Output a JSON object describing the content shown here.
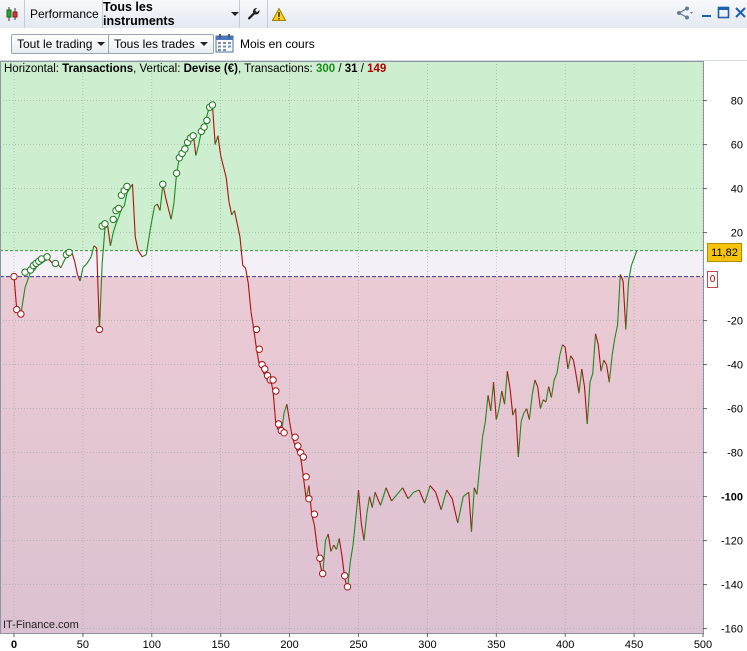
{
  "titlebar": {
    "tab_performance": "Performance",
    "tab_instruments": "Tous les instruments",
    "icon_app": "candlestick-icon",
    "icon_tools": "wrench-icon",
    "icon_warning": "warning-icon",
    "icon_share": "share-icon",
    "icon_minimize": "minimize-icon",
    "icon_maximize": "maximize-icon",
    "icon_close": "close-icon"
  },
  "toolbar": {
    "filter_trading": "Tout le trading",
    "filter_trades": "Tous les trades",
    "period_label": "Mois en cours",
    "icon_calendar": "calendar-icon"
  },
  "header": {
    "horizontal_label": "Horizontal: ",
    "horizontal_value": "Transactions",
    "vertical_label": ", Vertical: ",
    "vertical_value": "Devise (€)",
    "transactions_label": ", Transactions: ",
    "count_winning": "300",
    "separator1": " / ",
    "count_neutral": "31",
    "separator2": " / ",
    "count_losing": "149"
  },
  "footer": {
    "source": "IT-Finance.com"
  },
  "current_value_label": "11,82",
  "zero_marker_label": "0",
  "colors": {
    "positive_zone": "#cdeecf",
    "negative_zone": "#e6c8d3",
    "neutral_band": "#f4f0f8",
    "up_line": "#1e8a1e",
    "down_line": "#b01010",
    "win_count": "#1c8c1c",
    "loss_count": "#b00000",
    "current_badge": "#f6c40c"
  },
  "chart_data": {
    "type": "line",
    "xlim": [
      -10,
      500
    ],
    "ylim": [
      -162,
      98
    ],
    "x_ticks": [
      0,
      50,
      100,
      150,
      200,
      250,
      300,
      350,
      400,
      450,
      500
    ],
    "y_ticks": [
      80,
      60,
      40,
      20,
      -20,
      -40,
      -60,
      -80,
      -100,
      -120,
      -140,
      -160
    ],
    "grid": true,
    "current_value": 11.82,
    "neutral_band": [
      0,
      11.82
    ],
    "series": [
      {
        "points": [
          [
            0,
            0
          ],
          [
            2,
            -15
          ],
          [
            5,
            -17
          ],
          [
            8,
            -5
          ],
          [
            12,
            2
          ],
          [
            15,
            3
          ],
          [
            17,
            5
          ],
          [
            20,
            6
          ],
          [
            22,
            7
          ],
          [
            25,
            8
          ],
          [
            28,
            6
          ],
          [
            30,
            7
          ],
          [
            34,
            4
          ],
          [
            37,
            8
          ],
          [
            40,
            10
          ],
          [
            42,
            11
          ],
          [
            44,
            7
          ],
          [
            46,
            1
          ],
          [
            48,
            -2
          ],
          [
            50,
            4
          ],
          [
            53,
            6
          ],
          [
            56,
            9
          ],
          [
            58,
            14
          ],
          [
            60,
            13
          ],
          [
            62,
            -24
          ],
          [
            64,
            6
          ],
          [
            66,
            22
          ],
          [
            68,
            23
          ],
          [
            70,
            14
          ],
          [
            72,
            20
          ],
          [
            74,
            24
          ],
          [
            76,
            27
          ],
          [
            78,
            31
          ],
          [
            80,
            32
          ],
          [
            82,
            38
          ],
          [
            84,
            40
          ],
          [
            86,
            42
          ],
          [
            88,
            18
          ],
          [
            90,
            12
          ],
          [
            93,
            9
          ],
          [
            96,
            10
          ],
          [
            99,
            22
          ],
          [
            102,
            32
          ],
          [
            104,
            33
          ],
          [
            106,
            30
          ],
          [
            108,
            42
          ],
          [
            110,
            36
          ],
          [
            112,
            31
          ],
          [
            114,
            26
          ],
          [
            116,
            33
          ],
          [
            118,
            47
          ],
          [
            120,
            54
          ],
          [
            122,
            57
          ],
          [
            124,
            59
          ],
          [
            126,
            62
          ],
          [
            128,
            64
          ],
          [
            130,
            65
          ],
          [
            132,
            55
          ],
          [
            134,
            60
          ],
          [
            136,
            66
          ],
          [
            138,
            68
          ],
          [
            140,
            73
          ],
          [
            142,
            78
          ],
          [
            144,
            78
          ],
          [
            146,
            60
          ],
          [
            148,
            64
          ],
          [
            150,
            55
          ],
          [
            152,
            50
          ],
          [
            154,
            45
          ],
          [
            156,
            34
          ],
          [
            158,
            28
          ],
          [
            160,
            30
          ],
          [
            162,
            24
          ],
          [
            164,
            18
          ],
          [
            166,
            5
          ],
          [
            168,
            4
          ],
          [
            170,
            -3
          ],
          [
            172,
            -16
          ],
          [
            174,
            -24
          ],
          [
            176,
            -33
          ],
          [
            178,
            -40
          ],
          [
            180,
            -42
          ],
          [
            182,
            -45
          ],
          [
            184,
            -47
          ],
          [
            186,
            -46
          ],
          [
            188,
            -52
          ],
          [
            190,
            -67
          ],
          [
            192,
            -70
          ],
          [
            194,
            -71
          ],
          [
            196,
            -62
          ],
          [
            198,
            -58
          ],
          [
            200,
            -66
          ],
          [
            202,
            -73
          ],
          [
            204,
            -77
          ],
          [
            206,
            -80
          ],
          [
            208,
            -82
          ],
          [
            210,
            -91
          ],
          [
            212,
            -101
          ],
          [
            214,
            -95
          ],
          [
            216,
            -108
          ],
          [
            218,
            -113
          ],
          [
            220,
            -123
          ],
          [
            222,
            -130
          ],
          [
            224,
            -136
          ],
          [
            226,
            -120
          ],
          [
            228,
            -117
          ],
          [
            230,
            -125
          ],
          [
            232,
            -122
          ],
          [
            234,
            -124
          ],
          [
            236,
            -119
          ],
          [
            238,
            -127
          ],
          [
            240,
            -137
          ],
          [
            242,
            -142
          ],
          [
            244,
            -130
          ],
          [
            246,
            -122
          ],
          [
            248,
            -110
          ],
          [
            250,
            -97
          ],
          [
            252,
            -112
          ],
          [
            254,
            -120
          ],
          [
            256,
            -108
          ],
          [
            258,
            -100
          ],
          [
            260,
            -105
          ],
          [
            262,
            -98
          ],
          [
            266,
            -104
          ],
          [
            270,
            -96
          ],
          [
            274,
            -102
          ],
          [
            278,
            -99
          ],
          [
            282,
            -96
          ],
          [
            286,
            -101
          ],
          [
            290,
            -98
          ],
          [
            294,
            -97
          ],
          [
            298,
            -103
          ],
          [
            302,
            -95
          ],
          [
            306,
            -98
          ],
          [
            310,
            -106
          ],
          [
            314,
            -97
          ],
          [
            318,
            -101
          ],
          [
            322,
            -112
          ],
          [
            326,
            -100
          ],
          [
            330,
            -98
          ],
          [
            332,
            -116
          ],
          [
            334,
            -96
          ],
          [
            336,
            -99
          ],
          [
            338,
            -86
          ],
          [
            340,
            -73
          ],
          [
            342,
            -66
          ],
          [
            344,
            -54
          ],
          [
            346,
            -61
          ],
          [
            348,
            -48
          ],
          [
            350,
            -65
          ],
          [
            352,
            -60
          ],
          [
            354,
            -52
          ],
          [
            356,
            -58
          ],
          [
            358,
            -43
          ],
          [
            360,
            -51
          ],
          [
            362,
            -63
          ],
          [
            364,
            -60
          ],
          [
            366,
            -82
          ],
          [
            368,
            -66
          ],
          [
            370,
            -62
          ],
          [
            372,
            -60
          ],
          [
            374,
            -65
          ],
          [
            376,
            -54
          ],
          [
            378,
            -47
          ],
          [
            380,
            -50
          ],
          [
            382,
            -60
          ],
          [
            384,
            -56
          ],
          [
            386,
            -57
          ],
          [
            388,
            -50
          ],
          [
            390,
            -55
          ],
          [
            392,
            -47
          ],
          [
            394,
            -44
          ],
          [
            396,
            -36
          ],
          [
            398,
            -31
          ],
          [
            400,
            -32
          ],
          [
            402,
            -42
          ],
          [
            404,
            -36
          ],
          [
            406,
            -38
          ],
          [
            408,
            -45
          ],
          [
            410,
            -53
          ],
          [
            412,
            -42
          ],
          [
            414,
            -50
          ],
          [
            416,
            -67
          ],
          [
            418,
            -48
          ],
          [
            420,
            -44
          ],
          [
            422,
            -26
          ],
          [
            424,
            -31
          ],
          [
            426,
            -43
          ],
          [
            428,
            -38
          ],
          [
            430,
            -40
          ],
          [
            432,
            -48
          ],
          [
            434,
            -36
          ],
          [
            436,
            -28
          ],
          [
            438,
            -22
          ],
          [
            440,
            1
          ],
          [
            442,
            -2
          ],
          [
            444,
            -24
          ],
          [
            446,
            -2
          ],
          [
            448,
            5
          ],
          [
            452,
            11.82
          ]
        ],
        "markers_positive": [
          [
            8,
            2
          ],
          [
            12,
            3
          ],
          [
            14,
            5
          ],
          [
            16,
            6
          ],
          [
            18,
            7
          ],
          [
            20,
            8
          ],
          [
            24,
            9
          ],
          [
            30,
            6
          ],
          [
            38,
            10
          ],
          [
            40,
            11
          ],
          [
            64,
            23
          ],
          [
            66,
            24
          ],
          [
            72,
            26
          ],
          [
            74,
            30
          ],
          [
            76,
            31
          ],
          [
            78,
            37
          ],
          [
            80,
            39
          ],
          [
            82,
            41
          ],
          [
            108,
            42
          ],
          [
            118,
            47
          ],
          [
            120,
            54
          ],
          [
            122,
            56
          ],
          [
            124,
            58
          ],
          [
            126,
            61
          ],
          [
            128,
            63
          ],
          [
            130,
            64
          ],
          [
            136,
            66
          ],
          [
            138,
            68
          ],
          [
            140,
            71
          ],
          [
            142,
            77
          ],
          [
            144,
            78
          ]
        ],
        "markers_negative": [
          [
            0,
            0
          ],
          [
            2,
            -15
          ],
          [
            5,
            -17
          ],
          [
            62,
            -24
          ],
          [
            176,
            -24
          ],
          [
            178,
            -33
          ],
          [
            180,
            -40
          ],
          [
            182,
            -42
          ],
          [
            184,
            -45
          ],
          [
            186,
            -47
          ],
          [
            188,
            -47
          ],
          [
            190,
            -52
          ],
          [
            192,
            -67
          ],
          [
            194,
            -70
          ],
          [
            196,
            -71
          ],
          [
            204,
            -73
          ],
          [
            206,
            -77
          ],
          [
            208,
            -80
          ],
          [
            210,
            -82
          ],
          [
            212,
            -91
          ],
          [
            214,
            -101
          ],
          [
            218,
            -108
          ],
          [
            222,
            -128
          ],
          [
            224,
            -135
          ],
          [
            240,
            -136
          ],
          [
            242,
            -141
          ]
        ]
      }
    ]
  }
}
